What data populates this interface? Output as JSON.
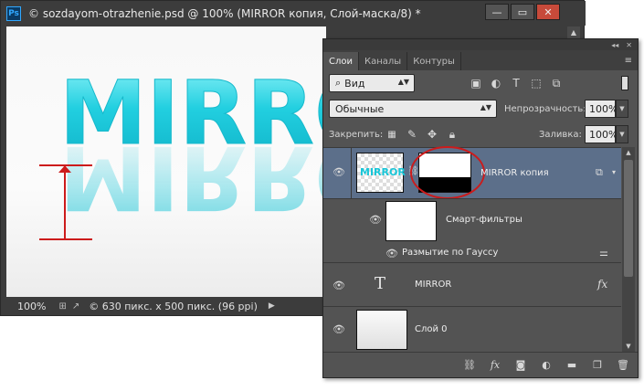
{
  "document": {
    "title": "© sozdayom-otrazhenie.psd @ 100% (MIRROR копия, Слой-маска/8) *",
    "canvas_text": "MIRROR",
    "status": {
      "zoom": "100%",
      "doc_info": "© 630 пикс. x 500 пикс. (96 ppi)"
    }
  },
  "window_buttons": {
    "minimize": "—",
    "maximize": "▭",
    "close": "✕"
  },
  "panel": {
    "tabs": [
      "Слои",
      "Каналы",
      "Контуры"
    ],
    "filter": {
      "value": "Вид"
    },
    "blend_mode": {
      "value": "Обычные"
    },
    "opacity": {
      "label": "Непрозрачность:",
      "value": "100%"
    },
    "lock": {
      "label": "Закрепить:"
    },
    "fill": {
      "label": "Заливка:",
      "value": "100%"
    },
    "layers": [
      {
        "name": "MIRROR копия",
        "selected": true
      },
      {
        "name": "Смарт-фильтры"
      },
      {
        "name": "Размытие по Гауссу"
      },
      {
        "name": "MIRROR",
        "type_glyph": "T",
        "fx": "fx"
      },
      {
        "name": "Слой 0"
      }
    ],
    "thumb_text": "MIRROR"
  },
  "colors": {
    "accent_cyan": "#1cc9d8",
    "annotation_red": "#cc1b1b",
    "selected_layer": "#5c6f8a"
  }
}
